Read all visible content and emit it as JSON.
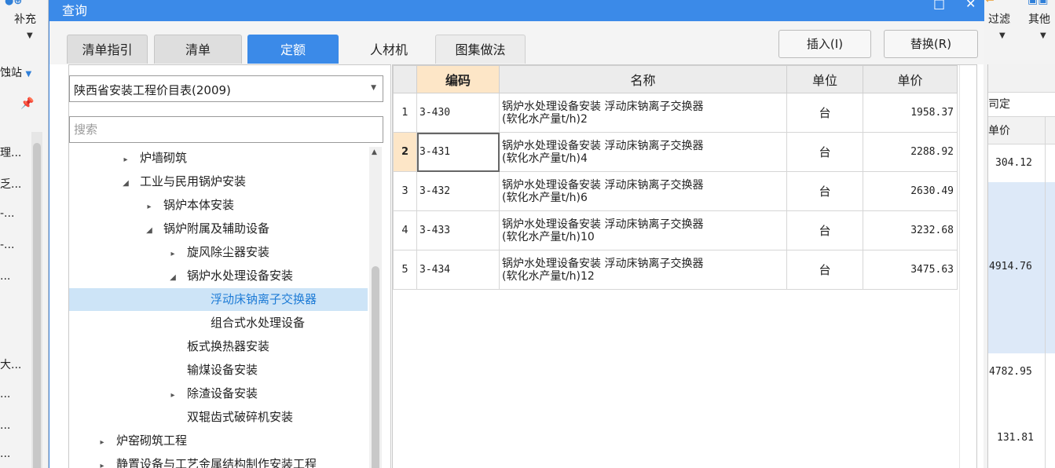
{
  "background_app": {
    "left_toolbar": {
      "supplement_label": "补充",
      "station_label": "蚀站",
      "rows": [
        "理...",
        "乏...",
        "-...",
        "-...",
        "...",
        "大...",
        "...",
        "...",
        "..."
      ]
    },
    "right_toolbar": {
      "filter_label": "过滤",
      "other_label": "其他"
    },
    "right_panel": {
      "header_fixed": "司定",
      "header_price": "单价",
      "values": [
        "304.12",
        "4914.76",
        "4782.95",
        "131.81"
      ]
    }
  },
  "dialog": {
    "title": "查询",
    "tabs": [
      {
        "label": "清单指引"
      },
      {
        "label": "清单"
      },
      {
        "label": "定额"
      },
      {
        "label": "人材机"
      },
      {
        "label": "图集做法"
      }
    ],
    "insert_label": "插入(I)",
    "replace_label": "替换(R)",
    "library": "陕西省安装工程价目表(2009)",
    "search_placeholder": "搜索",
    "tree": [
      {
        "label": "炉墙砌筑",
        "expander": "▸",
        "level": 1
      },
      {
        "label": "工业与民用锅炉安装",
        "expander": "◢",
        "level": 1
      },
      {
        "label": "锅炉本体安装",
        "expander": "▸",
        "level": 2
      },
      {
        "label": "锅炉附属及辅助设备",
        "expander": "◢",
        "level": 2
      },
      {
        "label": "旋风除尘器安装",
        "expander": "▸",
        "level": 3
      },
      {
        "label": "锅炉水处理设备安装",
        "expander": "◢",
        "level": 3
      },
      {
        "label": "浮动床钠离子交换器",
        "expander": "",
        "level": 4,
        "selected": true
      },
      {
        "label": "组合式水处理设备",
        "expander": "",
        "level": 4
      },
      {
        "label": "板式换热器安装",
        "expander": "",
        "level": 3
      },
      {
        "label": "输煤设备安装",
        "expander": "",
        "level": 3
      },
      {
        "label": "除渣设备安装",
        "expander": "▸",
        "level": 3
      },
      {
        "label": "双辊齿式破碎机安装",
        "expander": "",
        "level": 3
      },
      {
        "label": "炉窑砌筑工程",
        "expander": "▸",
        "level": 0
      },
      {
        "label": "静置设备与工艺金属结构制作安装工程",
        "expander": "▸",
        "level": 0
      }
    ],
    "table": {
      "headers": {
        "code": "编码",
        "name": "名称",
        "unit": "单位",
        "price": "单价"
      },
      "rows": [
        {
          "num": "1",
          "code": "3-430",
          "name1": "锅炉水处理设备安装 浮动床钠离子交换器",
          "name2": "(软化水产量t/h)2",
          "unit": "台",
          "price": "1958.37"
        },
        {
          "num": "2",
          "code": "3-431",
          "name1": "锅炉水处理设备安装 浮动床钠离子交换器",
          "name2": "(软化水产量t/h)4",
          "unit": "台",
          "price": "2288.92"
        },
        {
          "num": "3",
          "code": "3-432",
          "name1": "锅炉水处理设备安装 浮动床钠离子交换器",
          "name2": "(软化水产量t/h)6",
          "unit": "台",
          "price": "2630.49"
        },
        {
          "num": "4",
          "code": "3-433",
          "name1": "锅炉水处理设备安装 浮动床钠离子交换器",
          "name2": "(软化水产量t/h)10",
          "unit": "台",
          "price": "3232.68"
        },
        {
          "num": "5",
          "code": "3-434",
          "name1": "锅炉水处理设备安装 浮动床钠离子交换器",
          "name2": "(软化水产量t/h)12",
          "unit": "台",
          "price": "3475.63"
        }
      ]
    }
  }
}
